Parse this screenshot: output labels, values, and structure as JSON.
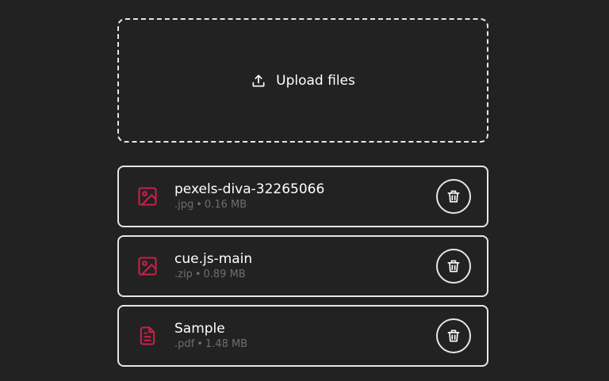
{
  "upload": {
    "label": "Upload files",
    "icon": "upload-icon"
  },
  "colors": {
    "background": "#222222",
    "border": "#e6e6e6",
    "accent": "#c8204a",
    "meta_text": "#6e6e6e"
  },
  "files": [
    {
      "name": "pexels-diva-32265066",
      "ext": ".jpg",
      "size": "0.16 MB",
      "icon": "image-icon"
    },
    {
      "name": "cue.js-main",
      "ext": ".zip",
      "size": "0.89 MB",
      "icon": "image-icon"
    },
    {
      "name": "Sample",
      "ext": ".pdf",
      "size": "1.48 MB",
      "icon": "document-icon"
    }
  ]
}
